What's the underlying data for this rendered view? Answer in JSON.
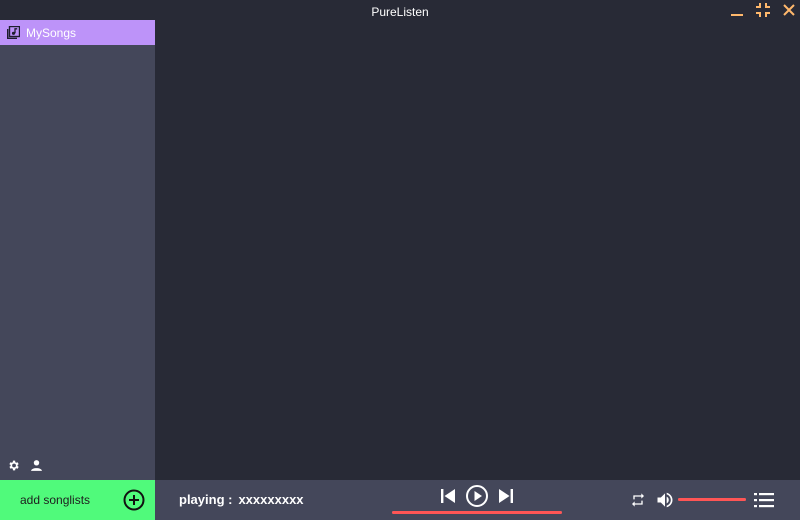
{
  "window": {
    "title": "PureListen"
  },
  "colors": {
    "background": "#282a36",
    "sidebar": "#44475a",
    "active_item": "#bd93f9",
    "add_button": "#50fa7b",
    "window_controls": "#ffb86c",
    "accent_bar": "#ff5555"
  },
  "sidebar": {
    "items": [
      {
        "label": "MySongs",
        "icon": "music-library-icon",
        "active": true
      }
    ],
    "tools": [
      {
        "icon": "gear-icon"
      },
      {
        "icon": "user-icon"
      }
    ]
  },
  "add_songlists": {
    "label": "add songlists",
    "icon": "plus-circle-icon"
  },
  "player": {
    "playing_label": "playing :",
    "track_name": "xxxxxxxxx",
    "progress": 1.0,
    "volume": 1.0,
    "controls": [
      "skip-previous-icon",
      "play-circle-icon",
      "skip-next-icon"
    ],
    "right_controls": [
      "repeat-icon",
      "volume-icon",
      "playlist-icon"
    ]
  }
}
